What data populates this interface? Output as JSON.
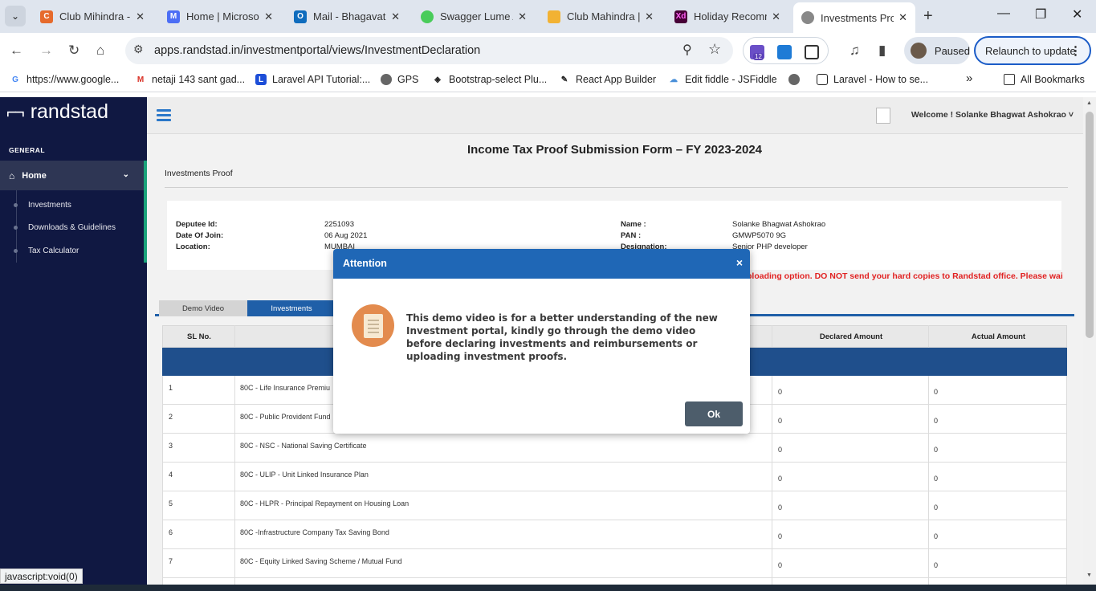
{
  "browser": {
    "tabs": [
      {
        "title": "Club Mihindra - (",
        "color": "#e66a2c"
      },
      {
        "title": "Home | Microsof",
        "color": "#4c6ef5"
      },
      {
        "title": "Mail - Bhagavat",
        "color": "#0f6cbd"
      },
      {
        "title": "Swagger Lume A",
        "color": "#49cc5a"
      },
      {
        "title": "Club Mahindra |",
        "color": "#f2b233"
      },
      {
        "title": "Holiday Recomm",
        "color": "#470137"
      },
      {
        "title": "Investments Pro",
        "color": "#666666"
      }
    ],
    "url": "apps.randstad.in/investmentportal/views/InvestmentDeclaration",
    "ext_badge": "12",
    "profile_status": "Paused",
    "relaunch_label": "Relaunch to update",
    "bookmarks": [
      "https://www.google...",
      "netaji 143 sant gad...",
      "Laravel API Tutorial:...",
      "GPS",
      "Bootstrap-select Plu...",
      "React App Builder",
      "Edit fiddle - JSFiddle",
      "",
      "Laravel - How to se..."
    ],
    "all_bookmarks": "All Bookmarks",
    "status_url": "javascript:void(0)"
  },
  "sidebar": {
    "brand": "randstad",
    "section": "GENERAL",
    "home": "Home",
    "items": [
      "Investments",
      "Downloads & Guidelines",
      "Tax Calculator"
    ]
  },
  "header": {
    "welcome": "Welcome ! Solanke Bhagwat Ashokrao ˅"
  },
  "form": {
    "title": "Income Tax Proof Submission Form – FY 2023-2024",
    "subtitle": "Investments Proof",
    "info": {
      "deputee_label": "Deputee Id:",
      "deputee": "2251093",
      "doj_label": "Date Of Join:",
      "doj": "06 Aug 2021",
      "location_label": "Location:",
      "location": "MUMBAI",
      "name_label": "Name :",
      "name": "Solanke Bhagwat Ashokrao",
      "pan_label": "PAN :",
      "pan": "GMWP5070 9G",
      "designation_label": "Designation:",
      "designation": "Senior PHP developer"
    },
    "notice": "ploading option. DO NOT send your hard copies to Randstad office. Please wai",
    "tabs": [
      "Demo Video",
      "Investments"
    ]
  },
  "table": {
    "headers": [
      "SL No.",
      "Declared Amount",
      "Actual Amount"
    ],
    "rows": [
      {
        "sl": "1",
        "desc": "80C - Life Insurance Premiu",
        "declared": "0",
        "actual": "0"
      },
      {
        "sl": "2",
        "desc": "80C - Public Provident Fund",
        "declared": "0",
        "actual": "0"
      },
      {
        "sl": "3",
        "desc": "80C - NSC - National Saving Certificate",
        "declared": "0",
        "actual": "0"
      },
      {
        "sl": "4",
        "desc": "80C - ULIP - Unit Linked Insurance Plan",
        "declared": "0",
        "actual": "0"
      },
      {
        "sl": "5",
        "desc": "80C - HLPR - Principal Repayment on Housing Loan",
        "declared": "0",
        "actual": "0"
      },
      {
        "sl": "6",
        "desc": "80C -Infrastructure Company Tax Saving Bond",
        "declared": "0",
        "actual": "0"
      },
      {
        "sl": "7",
        "desc": "80C - Equity Linked Saving Scheme / Mutual Fund",
        "declared": "0",
        "actual": "0"
      }
    ]
  },
  "modal": {
    "title": "Attention",
    "close": "×",
    "message": "This demo video is for a better understanding of the new Investment portal, kindly go through the demo video before declaring investments and reimbursements or uploading investment proofs.",
    "ok": "Ok"
  }
}
